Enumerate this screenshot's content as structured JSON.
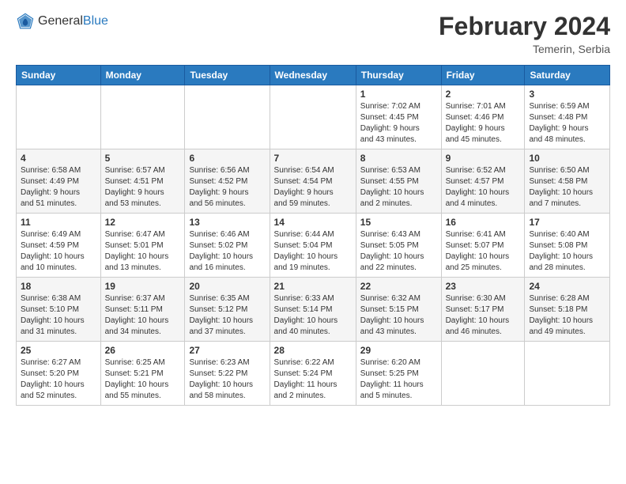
{
  "header": {
    "logo": {
      "general": "General",
      "blue": "Blue"
    },
    "title": "February 2024",
    "location": "Temerin, Serbia"
  },
  "days_of_week": [
    "Sunday",
    "Monday",
    "Tuesday",
    "Wednesday",
    "Thursday",
    "Friday",
    "Saturday"
  ],
  "weeks": [
    [
      {
        "day": "",
        "info": ""
      },
      {
        "day": "",
        "info": ""
      },
      {
        "day": "",
        "info": ""
      },
      {
        "day": "",
        "info": ""
      },
      {
        "day": "1",
        "info": "Sunrise: 7:02 AM\nSunset: 4:45 PM\nDaylight: 9 hours\nand 43 minutes."
      },
      {
        "day": "2",
        "info": "Sunrise: 7:01 AM\nSunset: 4:46 PM\nDaylight: 9 hours\nand 45 minutes."
      },
      {
        "day": "3",
        "info": "Sunrise: 6:59 AM\nSunset: 4:48 PM\nDaylight: 9 hours\nand 48 minutes."
      }
    ],
    [
      {
        "day": "4",
        "info": "Sunrise: 6:58 AM\nSunset: 4:49 PM\nDaylight: 9 hours\nand 51 minutes."
      },
      {
        "day": "5",
        "info": "Sunrise: 6:57 AM\nSunset: 4:51 PM\nDaylight: 9 hours\nand 53 minutes."
      },
      {
        "day": "6",
        "info": "Sunrise: 6:56 AM\nSunset: 4:52 PM\nDaylight: 9 hours\nand 56 minutes."
      },
      {
        "day": "7",
        "info": "Sunrise: 6:54 AM\nSunset: 4:54 PM\nDaylight: 9 hours\nand 59 minutes."
      },
      {
        "day": "8",
        "info": "Sunrise: 6:53 AM\nSunset: 4:55 PM\nDaylight: 10 hours\nand 2 minutes."
      },
      {
        "day": "9",
        "info": "Sunrise: 6:52 AM\nSunset: 4:57 PM\nDaylight: 10 hours\nand 4 minutes."
      },
      {
        "day": "10",
        "info": "Sunrise: 6:50 AM\nSunset: 4:58 PM\nDaylight: 10 hours\nand 7 minutes."
      }
    ],
    [
      {
        "day": "11",
        "info": "Sunrise: 6:49 AM\nSunset: 4:59 PM\nDaylight: 10 hours\nand 10 minutes."
      },
      {
        "day": "12",
        "info": "Sunrise: 6:47 AM\nSunset: 5:01 PM\nDaylight: 10 hours\nand 13 minutes."
      },
      {
        "day": "13",
        "info": "Sunrise: 6:46 AM\nSunset: 5:02 PM\nDaylight: 10 hours\nand 16 minutes."
      },
      {
        "day": "14",
        "info": "Sunrise: 6:44 AM\nSunset: 5:04 PM\nDaylight: 10 hours\nand 19 minutes."
      },
      {
        "day": "15",
        "info": "Sunrise: 6:43 AM\nSunset: 5:05 PM\nDaylight: 10 hours\nand 22 minutes."
      },
      {
        "day": "16",
        "info": "Sunrise: 6:41 AM\nSunset: 5:07 PM\nDaylight: 10 hours\nand 25 minutes."
      },
      {
        "day": "17",
        "info": "Sunrise: 6:40 AM\nSunset: 5:08 PM\nDaylight: 10 hours\nand 28 minutes."
      }
    ],
    [
      {
        "day": "18",
        "info": "Sunrise: 6:38 AM\nSunset: 5:10 PM\nDaylight: 10 hours\nand 31 minutes."
      },
      {
        "day": "19",
        "info": "Sunrise: 6:37 AM\nSunset: 5:11 PM\nDaylight: 10 hours\nand 34 minutes."
      },
      {
        "day": "20",
        "info": "Sunrise: 6:35 AM\nSunset: 5:12 PM\nDaylight: 10 hours\nand 37 minutes."
      },
      {
        "day": "21",
        "info": "Sunrise: 6:33 AM\nSunset: 5:14 PM\nDaylight: 10 hours\nand 40 minutes."
      },
      {
        "day": "22",
        "info": "Sunrise: 6:32 AM\nSunset: 5:15 PM\nDaylight: 10 hours\nand 43 minutes."
      },
      {
        "day": "23",
        "info": "Sunrise: 6:30 AM\nSunset: 5:17 PM\nDaylight: 10 hours\nand 46 minutes."
      },
      {
        "day": "24",
        "info": "Sunrise: 6:28 AM\nSunset: 5:18 PM\nDaylight: 10 hours\nand 49 minutes."
      }
    ],
    [
      {
        "day": "25",
        "info": "Sunrise: 6:27 AM\nSunset: 5:20 PM\nDaylight: 10 hours\nand 52 minutes."
      },
      {
        "day": "26",
        "info": "Sunrise: 6:25 AM\nSunset: 5:21 PM\nDaylight: 10 hours\nand 55 minutes."
      },
      {
        "day": "27",
        "info": "Sunrise: 6:23 AM\nSunset: 5:22 PM\nDaylight: 10 hours\nand 58 minutes."
      },
      {
        "day": "28",
        "info": "Sunrise: 6:22 AM\nSunset: 5:24 PM\nDaylight: 11 hours\nand 2 minutes."
      },
      {
        "day": "29",
        "info": "Sunrise: 6:20 AM\nSunset: 5:25 PM\nDaylight: 11 hours\nand 5 minutes."
      },
      {
        "day": "",
        "info": ""
      },
      {
        "day": "",
        "info": ""
      }
    ]
  ]
}
